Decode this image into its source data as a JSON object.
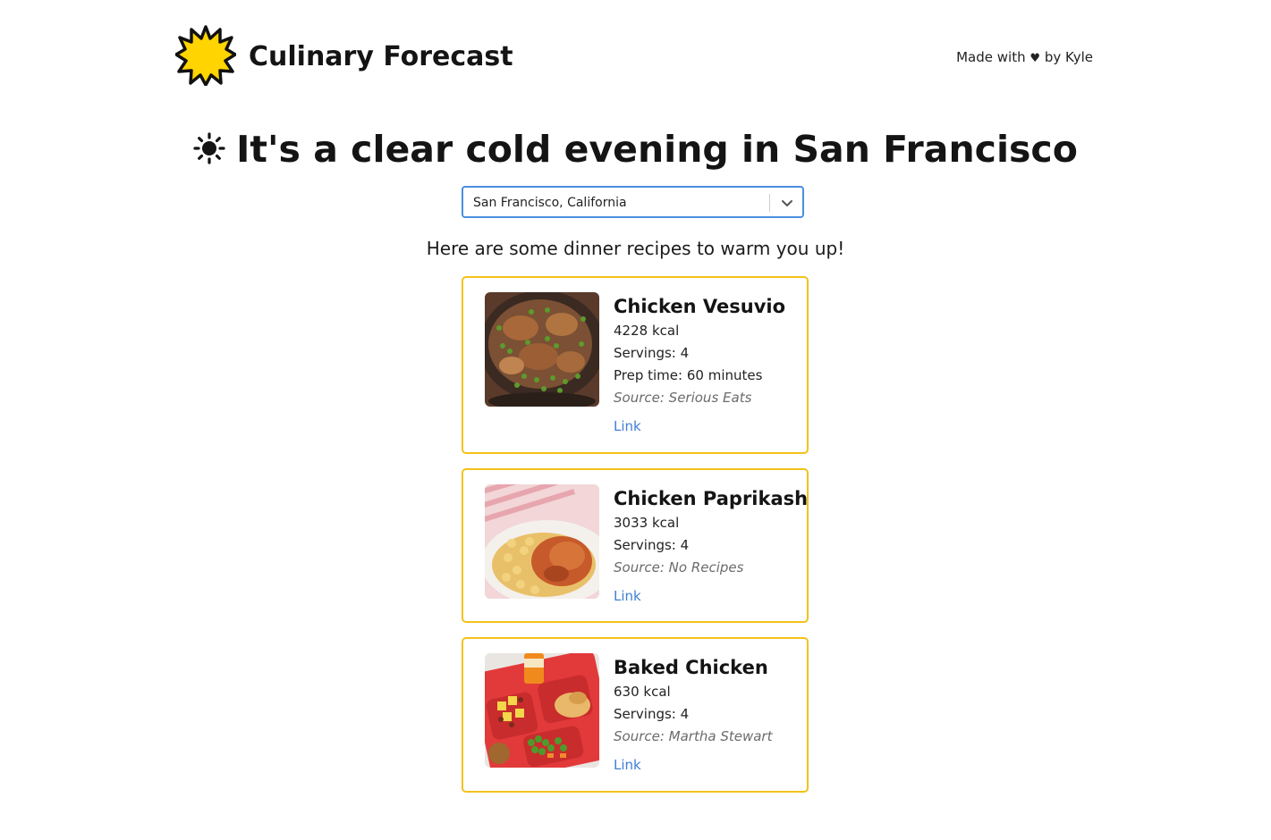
{
  "header": {
    "brand": "Culinary Forecast",
    "made_with_prefix": "Made with",
    "heart": "♥",
    "made_with_suffix": "by Kyle",
    "logo_icon": "sun-burst-icon"
  },
  "headline": {
    "icon": "sun-icon",
    "text": "It's a clear cold evening in San Francisco"
  },
  "location_select": {
    "value": "San Francisco, California"
  },
  "intro": "Here are some dinner recipes to warm you up!",
  "recipes": [
    {
      "title": "Chicken Vesuvio",
      "calories": "4228 kcal",
      "servings": "Servings: 4",
      "prep_time": "Prep time: 60 minutes",
      "source": "Source: Serious Eats",
      "link": "Link"
    },
    {
      "title": "Chicken Paprikash",
      "calories": "3033 kcal",
      "servings": "Servings: 4",
      "source": "Source: No Recipes",
      "link": "Link"
    },
    {
      "title": "Baked Chicken",
      "calories": "630 kcal",
      "servings": "Servings: 4",
      "source": "Source: Martha Stewart",
      "link": "Link"
    }
  ],
  "colors": {
    "card_border": "#f2c21b",
    "link": "#3f7fd6",
    "select_border": "#4a8fe0",
    "logo_fill": "#ffd400"
  }
}
